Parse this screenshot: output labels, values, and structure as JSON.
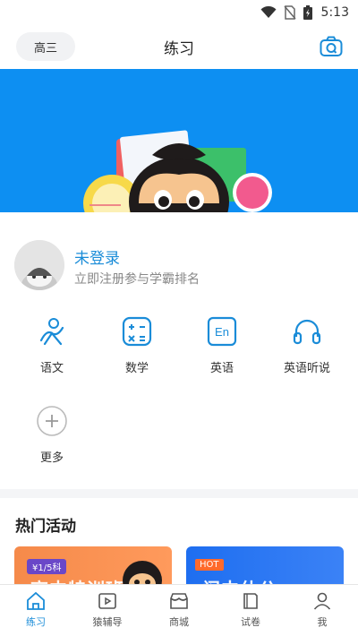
{
  "status_bar": {
    "time": "5:13"
  },
  "header": {
    "grade": "高三",
    "title": "练习"
  },
  "profile": {
    "title": "未登录",
    "subtitle": "立即注册参与学霸排名"
  },
  "subjects": [
    {
      "label": "语文",
      "icon": "chinese-icon"
    },
    {
      "label": "数学",
      "icon": "math-icon"
    },
    {
      "label": "英语",
      "icon": "english-icon",
      "icon_text": "En"
    },
    {
      "label": "英语听说",
      "icon": "headphones-icon"
    },
    {
      "label": "更多",
      "icon": "plus-icon"
    }
  ],
  "activities": {
    "title": "热门活动",
    "cards": [
      {
        "tag": "¥1/5科",
        "text": "高中特训班"
      },
      {
        "tag": "HOT",
        "text": "闷中什公"
      }
    ]
  },
  "tabs": [
    {
      "label": "练习",
      "icon": "home-icon",
      "active": true
    },
    {
      "label": "猿辅导",
      "icon": "play-icon"
    },
    {
      "label": "商城",
      "icon": "store-icon"
    },
    {
      "label": "试卷",
      "icon": "paper-icon"
    },
    {
      "label": "我",
      "icon": "person-icon"
    }
  ],
  "colors": {
    "accent": "#1a8cd8",
    "banner": "#0d8ff2"
  }
}
